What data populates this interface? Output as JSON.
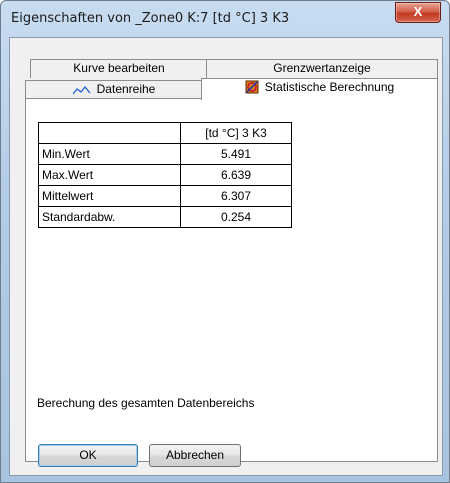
{
  "window": {
    "title": "Eigenschaften von _Zone0 K:7 [td °C] 3 K3",
    "close_label": "X"
  },
  "tabs": {
    "row1": [
      "Kurve bearbeiten",
      "Grenzwertanzeige"
    ],
    "row2": [
      "Datenreihe",
      "Statistische Berechnung"
    ],
    "active": "Statistische Berechnung"
  },
  "stats": {
    "column_header": "[td °C] 3 K3",
    "rows": [
      {
        "label": "Min.Wert",
        "value": "5.491"
      },
      {
        "label": "Max.Wert",
        "value": "6.639"
      },
      {
        "label": "Mittelwert",
        "value": "6.307"
      },
      {
        "label": "Standardabw.",
        "value": "0.254"
      }
    ]
  },
  "note": "Berechung des gesamten Datenbereichs",
  "buttons": {
    "ok": "OK",
    "cancel": "Abbrechen"
  },
  "icons": {
    "datenreihe": "line-chart-icon",
    "statistik": "statistics-icon"
  },
  "colors": {
    "chart_line_blue": "#1f5fd6",
    "stat_icon_orange": "#e07b1a",
    "stat_icon_red": "#c0182a"
  }
}
